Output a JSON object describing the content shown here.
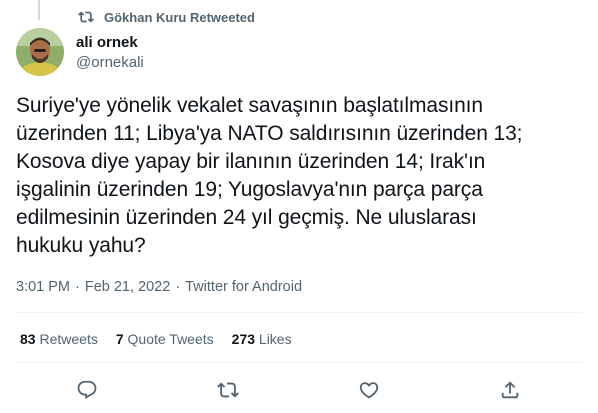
{
  "retweet_context": {
    "icon": "retweet-icon",
    "text": "Gökhan Kuru Retweeted"
  },
  "author": {
    "name": "ali ornek",
    "handle": "@ornekali"
  },
  "tweet": {
    "text": "Suriye'ye yönelik vekalet savaşının başlatılmasının\nüzerinden 11; Libya'ya NATO saldırısının üzerinden 13;\nKosova diye yapay bir ilanının üzerinden 14; Irak'ın\nişgalinin üzerinden 19; Yugoslavya'nın parça parça\nedilmesinin üzerinden 24 yıl geçmiş. Ne uluslarası\nhukuku yahu?"
  },
  "meta": {
    "time": "3:01 PM",
    "separator1": "·",
    "date": "Feb 21, 2022",
    "separator2": "·",
    "source": "Twitter for Android"
  },
  "stats": {
    "retweets_count": "83",
    "retweets_label": "Retweets",
    "quotes_count": "7",
    "quotes_label": "Quote Tweets",
    "likes_count": "273",
    "likes_label": "Likes"
  },
  "actions": {
    "reply_icon": "reply-icon",
    "retweet_icon": "retweet-icon",
    "like_icon": "heart-icon",
    "share_icon": "share-icon"
  },
  "colors": {
    "primary_text": "#0f1419",
    "secondary_text": "#536471",
    "divider": "#eff3f4"
  }
}
